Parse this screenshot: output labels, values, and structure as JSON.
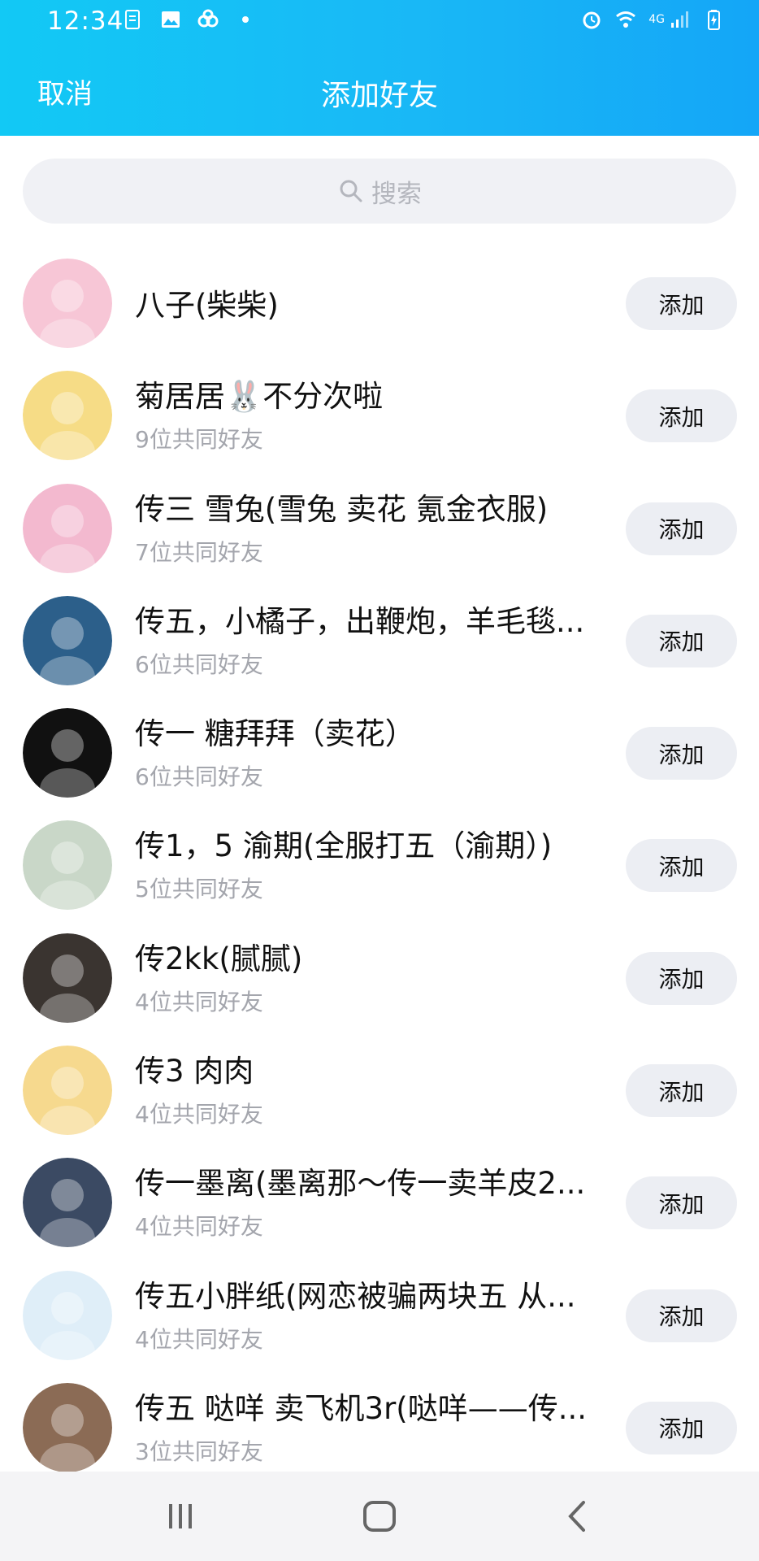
{
  "status": {
    "time": "12:34",
    "network": "4G"
  },
  "header": {
    "cancel_label": "取消",
    "title": "添加好友"
  },
  "search": {
    "placeholder": "搜索"
  },
  "friends": [
    {
      "name": "八子(柴柴)",
      "mutual": "",
      "add_label": "添加",
      "avatar_color": "#f7c6d6"
    },
    {
      "name": "菊居居🐰不分次啦",
      "mutual": "9位共同好友",
      "add_label": "添加",
      "avatar_color": "#f6dc86"
    },
    {
      "name": "传三 雪兔(雪兔 卖花 氪金衣服)",
      "mutual": "7位共同好友",
      "add_label": "添加",
      "avatar_color": "#f3b9cf"
    },
    {
      "name": "传五，小橘子，出鞭炮，羊毛毯...",
      "mutual": "6位共同好友",
      "add_label": "添加",
      "avatar_color": "#2c5f8a"
    },
    {
      "name": "传一 糖拜拜（卖花）",
      "mutual": "6位共同好友",
      "add_label": "添加",
      "avatar_color": "#111111"
    },
    {
      "name": "传1，5 渝期(全服打五（渝期）)",
      "mutual": "5位共同好友",
      "add_label": "添加",
      "avatar_color": "#c9d7c8"
    },
    {
      "name": "传2kk(腻腻)",
      "mutual": "4位共同好友",
      "add_label": "添加",
      "avatar_color": "#3a3430"
    },
    {
      "name": "传3 肉肉",
      "mutual": "4位共同好友",
      "add_label": "添加",
      "avatar_color": "#f6d98e"
    },
    {
      "name": "传一墨离(墨离那～传一卖羊皮2...",
      "mutual": "4位共同好友",
      "add_label": "添加",
      "avatar_color": "#3b4a63"
    },
    {
      "name": "传五小胖纸(网恋被骗两块五 从...",
      "mutual": "4位共同好友",
      "add_label": "添加",
      "avatar_color": "#dfeef8"
    },
    {
      "name": "传五 哒咩 卖飞机3r(哒咩——传...",
      "mutual": "3位共同好友",
      "add_label": "添加",
      "avatar_color": "#8b6b55"
    }
  ],
  "navbar": {
    "buttons": [
      "recents-icon",
      "home-icon",
      "back-icon"
    ]
  }
}
